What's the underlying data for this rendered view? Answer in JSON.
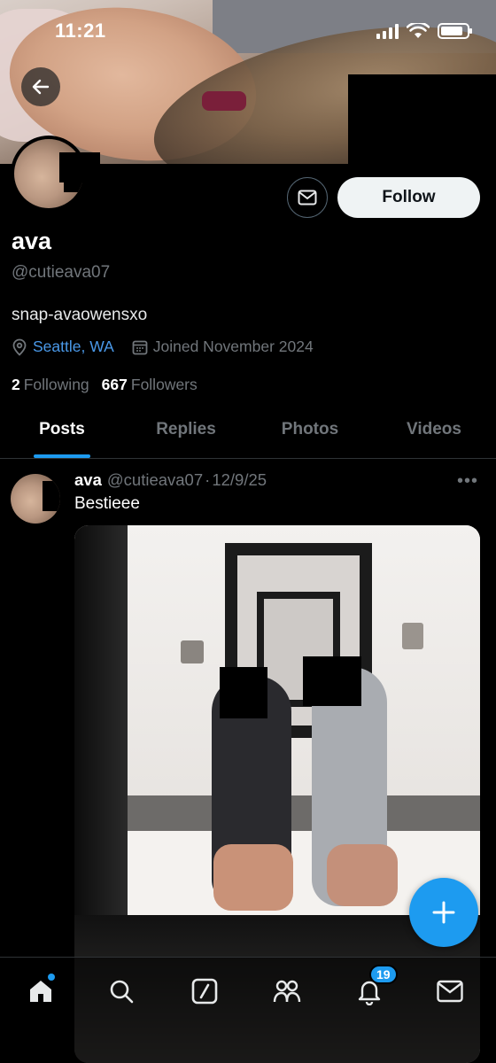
{
  "status_bar": {
    "time": "11:21"
  },
  "profile": {
    "display_name": "ava",
    "handle": "@cutieava07",
    "bio": "snap-avaowensxo",
    "location": "Seattle, WA",
    "joined": "Joined November 2024",
    "following_count": "2",
    "following_label": "Following",
    "followers_count": "667",
    "followers_label": "Followers",
    "follow_label": "Follow"
  },
  "tabs": [
    {
      "label": "Posts",
      "active": true
    },
    {
      "label": "Replies",
      "active": false
    },
    {
      "label": "Photos",
      "active": false
    },
    {
      "label": "Videos",
      "active": false
    }
  ],
  "post": {
    "author_name": "ava",
    "author_handle": "@cutieava07",
    "separator": "·",
    "date": "12/9/25",
    "more": "•••",
    "text": "Bestieee"
  },
  "bottom_nav": {
    "items": [
      "home-icon",
      "search-icon",
      "grok-icon",
      "communities-icon",
      "notifications-icon",
      "messages-icon"
    ],
    "notifications_badge": "19"
  },
  "colors": {
    "accent": "#1d9bf0",
    "background": "#000000",
    "secondary_text": "#71767b",
    "link": "#4a99e9"
  }
}
